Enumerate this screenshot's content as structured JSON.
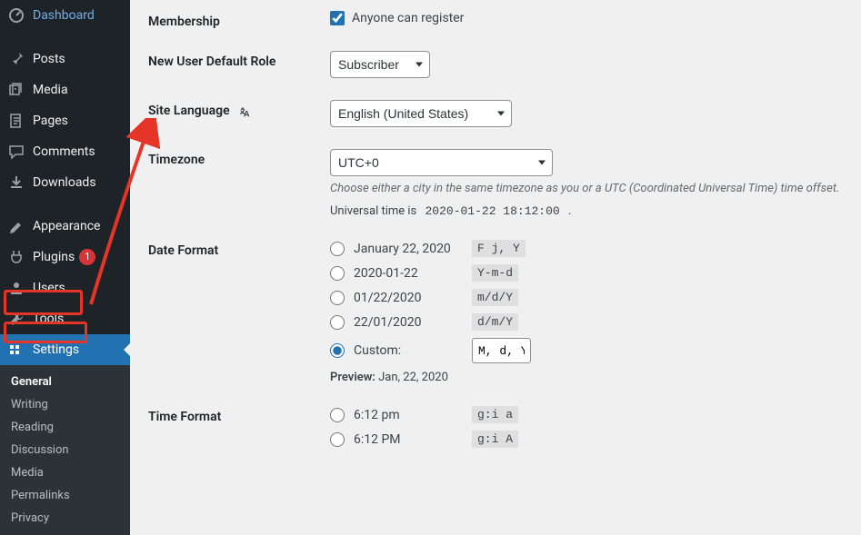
{
  "sidebar": {
    "items": [
      {
        "label": "Dashboard",
        "icon": "dashboard"
      },
      {
        "label": "Posts",
        "icon": "pin"
      },
      {
        "label": "Media",
        "icon": "media"
      },
      {
        "label": "Pages",
        "icon": "pages"
      },
      {
        "label": "Comments",
        "icon": "comments"
      },
      {
        "label": "Downloads",
        "icon": "downloads"
      },
      {
        "label": "Appearance",
        "icon": "appearance"
      },
      {
        "label": "Plugins",
        "icon": "plugins",
        "badge": "1"
      },
      {
        "label": "Users",
        "icon": "users"
      },
      {
        "label": "Tools",
        "icon": "tools"
      },
      {
        "label": "Settings",
        "icon": "settings",
        "current": true
      }
    ],
    "submenu": [
      {
        "label": "General",
        "current": true
      },
      {
        "label": "Writing"
      },
      {
        "label": "Reading"
      },
      {
        "label": "Discussion"
      },
      {
        "label": "Media"
      },
      {
        "label": "Permalinks"
      },
      {
        "label": "Privacy"
      }
    ]
  },
  "form": {
    "membership": {
      "label": "Membership",
      "checkbox_label": "Anyone can register",
      "checked": true
    },
    "default_role": {
      "label": "New User Default Role",
      "value": "Subscriber"
    },
    "site_language": {
      "label": "Site Language",
      "value": "English (United States)"
    },
    "timezone": {
      "label": "Timezone",
      "value": "UTC+0",
      "desc": "Choose either a city in the same timezone as you or a UTC (Coordinated Universal Time) time offset.",
      "utc_prefix": "Universal time is ",
      "utc_value": "2020-01-22 18:12:00",
      "utc_suffix": " ."
    },
    "date_format": {
      "label": "Date Format",
      "options": [
        {
          "display": "January 22, 2020",
          "code": "F j, Y"
        },
        {
          "display": "2020-01-22",
          "code": "Y-m-d"
        },
        {
          "display": "01/22/2020",
          "code": "m/d/Y"
        },
        {
          "display": "22/01/2020",
          "code": "d/m/Y"
        }
      ],
      "custom_label": "Custom:",
      "custom_value": "M, d, Y",
      "preview_label": "Preview:",
      "preview_value": "Jan, 22, 2020"
    },
    "time_format": {
      "label": "Time Format",
      "options": [
        {
          "display": "6:12 pm",
          "code": "g:i a"
        },
        {
          "display": "6:12 PM",
          "code": "g:i A"
        }
      ]
    }
  }
}
